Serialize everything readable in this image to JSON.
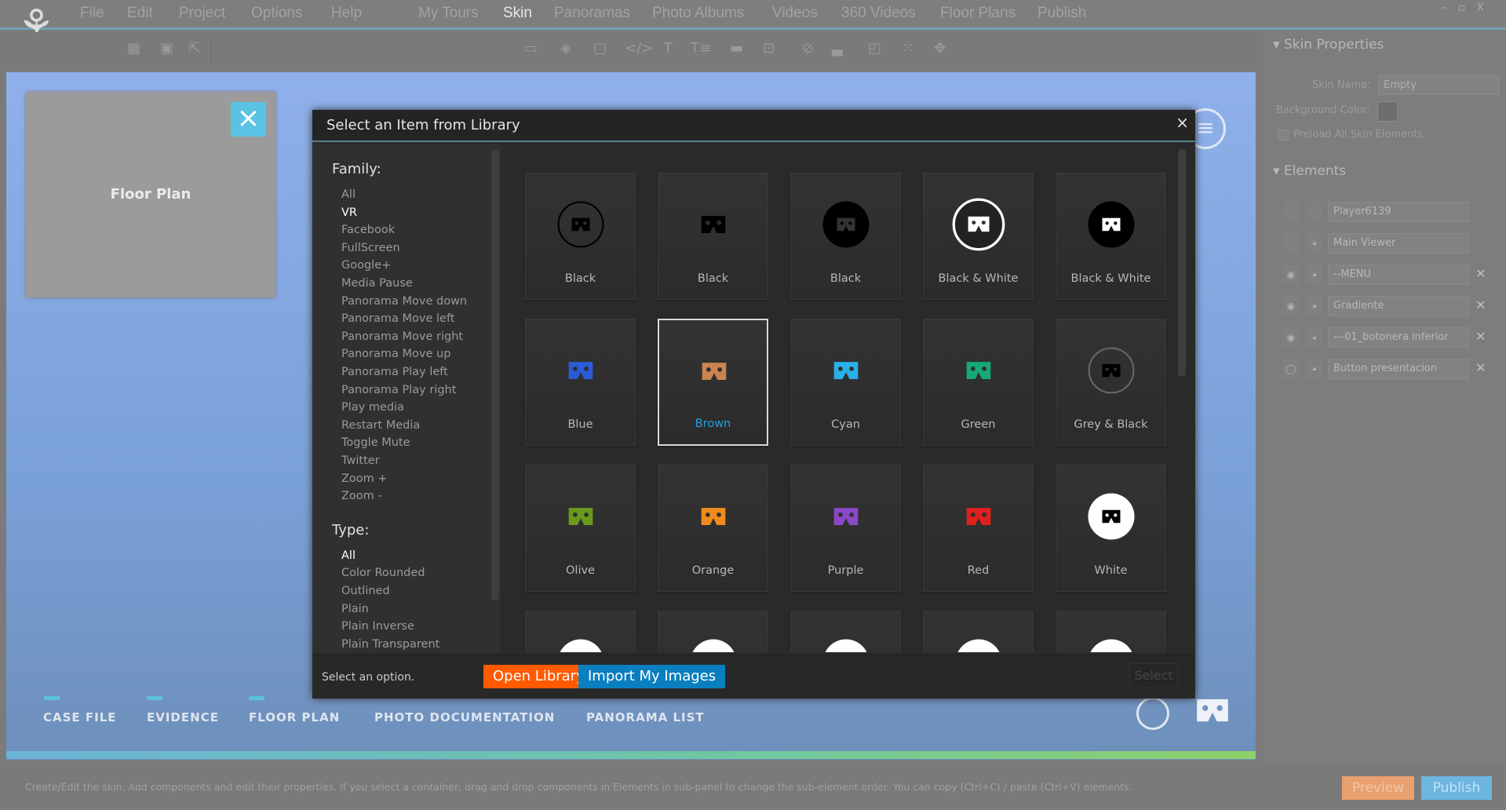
{
  "menubar": {
    "items": [
      "File",
      "Edit",
      "Project",
      "Options",
      "Help"
    ],
    "tabs": [
      "My Tours",
      "Skin",
      "Panoramas",
      "Photo Albums",
      "Videos",
      "360 Videos",
      "Floor Plans",
      "Publish"
    ],
    "active_tab": "Skin"
  },
  "canvas": {
    "floor_plan_label": "Floor Plan",
    "nav": [
      "CASE FILE",
      "EVIDENCE",
      "FLOOR PLAN",
      "PHOTO DOCUMENTATION",
      "PANORAMA LIST"
    ]
  },
  "right_panel": {
    "skin_properties": "Skin Properties",
    "skin_name_label": "Skin Name:",
    "skin_name_value": "Empty",
    "bg_color_label": "Background Color:",
    "preload_label": "Preload All Skin Elements",
    "elements_title": "Elements",
    "elements": [
      {
        "name": "Player6139",
        "visible": null,
        "deletable": false
      },
      {
        "name": "Main Viewer",
        "visible": null,
        "deletable": false
      },
      {
        "name": "--MENU",
        "visible": true,
        "deletable": true
      },
      {
        "name": "Gradiente",
        "visible": true,
        "deletable": true
      },
      {
        "name": "---01_botonera inferior",
        "visible": true,
        "deletable": true
      },
      {
        "name": "Button presentacion",
        "visible": false,
        "deletable": true
      }
    ]
  },
  "status": {
    "text": "Create/Edit the skin. Add components and edit their properties. If you select a container, drag and drop components in Elements in sub-panel to change the sub-element order. You can copy (Ctrl+C) / paste (Ctrl+V) elements.",
    "preview": "Preview",
    "publish": "Publish"
  },
  "dialog": {
    "title": "Select an Item from Library",
    "close": "×",
    "family_label": "Family:",
    "family": [
      "All",
      "VR",
      "Facebook",
      "FullScreen",
      "Google+",
      "Media Pause",
      "Panorama Move down",
      "Panorama Move left",
      "Panorama Move right",
      "Panorama Move up",
      "Panorama Play left",
      "Panorama Play right",
      "Play media",
      "Restart Media",
      "Toggle Mute",
      "Twitter",
      "Zoom +",
      "Zoom -"
    ],
    "family_selected": "VR",
    "type_label": "Type:",
    "type": [
      "All",
      "Color Rounded",
      "Outlined",
      "Plain",
      "Plain Inverse",
      "Plain Transparent"
    ],
    "type_selected": "All",
    "items": [
      {
        "label": "Black",
        "style": "outline",
        "color": "#000000"
      },
      {
        "label": "Black",
        "style": "plain",
        "color": "#000000"
      },
      {
        "label": "Black",
        "style": "disc",
        "color": "#000000"
      },
      {
        "label": "Black & White",
        "style": "ring-white",
        "color": "#ffffff"
      },
      {
        "label": "Black & White",
        "style": "disc-white-icon",
        "color": "#000000"
      },
      {
        "label": "Blue",
        "style": "plain",
        "color": "#2a5bd8"
      },
      {
        "label": "Brown",
        "style": "plain",
        "color": "#c98450"
      },
      {
        "label": "Cyan",
        "style": "plain",
        "color": "#2ab0e8"
      },
      {
        "label": "Green",
        "style": "plain",
        "color": "#16a878"
      },
      {
        "label": "Grey & Black",
        "style": "grey-ring",
        "color": "#000000"
      },
      {
        "label": "Olive",
        "style": "plain",
        "color": "#6a9a1c"
      },
      {
        "label": "Orange",
        "style": "plain",
        "color": "#f08a1c"
      },
      {
        "label": "Purple",
        "style": "plain",
        "color": "#8a48c8"
      },
      {
        "label": "Red",
        "style": "plain",
        "color": "#e0201e"
      },
      {
        "label": "White",
        "style": "white-disc",
        "color": "#ffffff"
      },
      {
        "label": "",
        "style": "white-disc",
        "color": "#ffffff"
      },
      {
        "label": "",
        "style": "white-disc",
        "color": "#ffffff"
      },
      {
        "label": "",
        "style": "white-disc",
        "color": "#ffffff"
      },
      {
        "label": "",
        "style": "white-disc",
        "color": "#ffffff"
      },
      {
        "label": "",
        "style": "white-disc",
        "color": "#ffffff"
      }
    ],
    "selected_item": "Brown",
    "footer_text": "Select an option.",
    "open_library": "Open Library",
    "import_images": "Import My Images",
    "select": "Select",
    "open_color": "#ff5a00",
    "import_color": "#0a7fc0"
  }
}
